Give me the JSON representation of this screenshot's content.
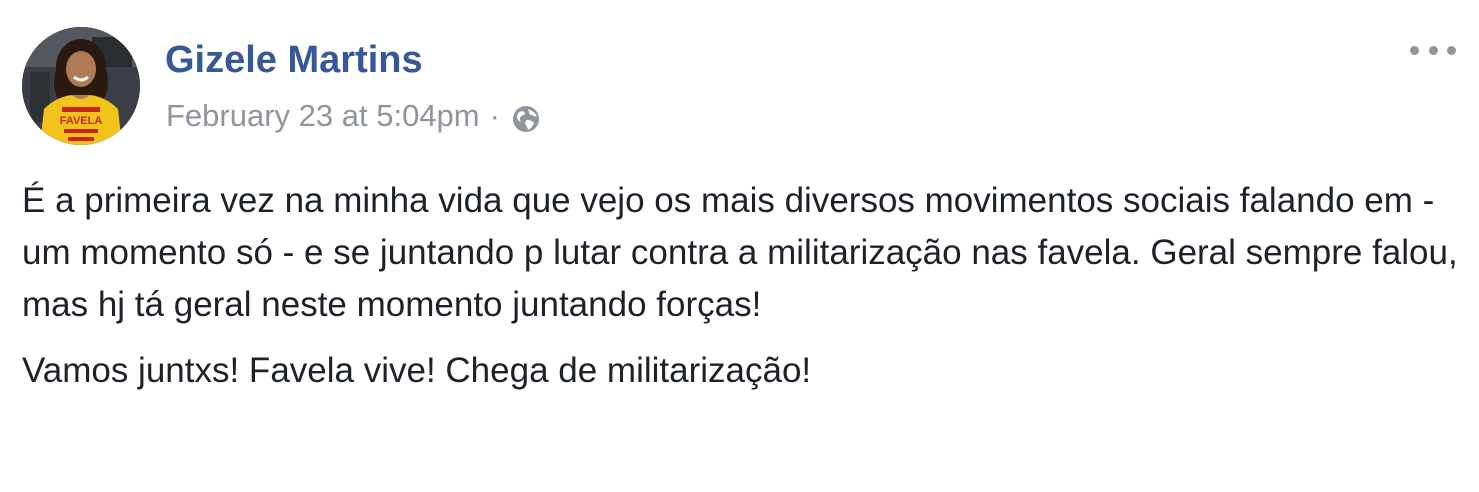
{
  "post": {
    "author": "Gizele Martins",
    "timestamp": "February 23 at 5:04pm",
    "separator": "·",
    "privacy_icon": "globe-icon",
    "options_icon": "more-horizontal-icon",
    "avatar_shirt_text": "FAVELA",
    "paragraphs": [
      "É a primeira vez na minha vida que vejo os mais diversos movimentos sociais falando em - um momento só - e se juntando p lutar contra a militarização nas favela. Geral sempre falou, mas hj tá geral neste momento juntando forças!",
      "Vamos juntxs! Favela vive! Chega de militarização!"
    ]
  },
  "colors": {
    "author_link": "#365899",
    "meta_text": "#90949c",
    "body_text": "#1d2129",
    "shirt_yellow": "#f2c31b",
    "shirt_red": "#c8251d"
  }
}
